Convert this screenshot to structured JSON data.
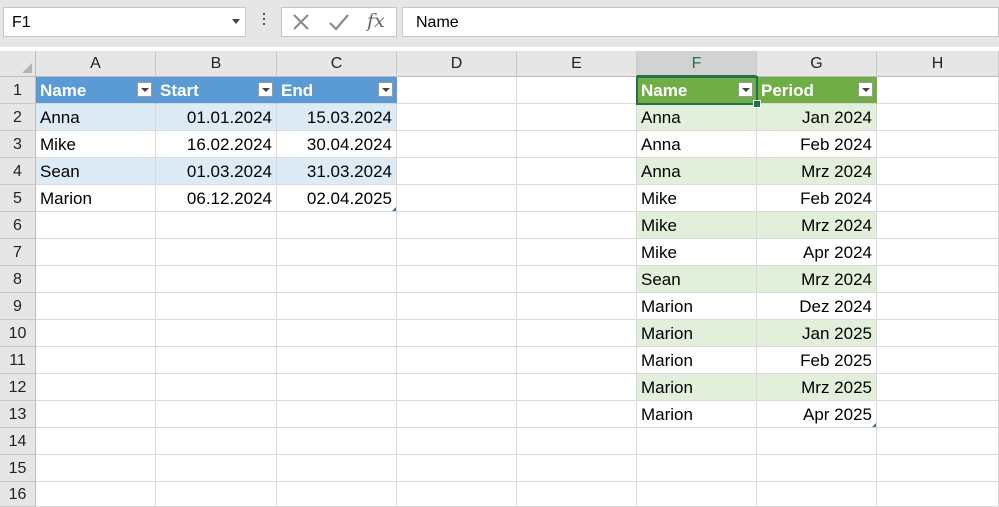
{
  "formula_bar": {
    "name_box": "F1",
    "formula": "Name",
    "fx_label": "fx"
  },
  "grid": {
    "columns": [
      "A",
      "B",
      "C",
      "D",
      "E",
      "F",
      "G",
      "H"
    ],
    "selected_column": "F",
    "rows": [
      "1",
      "2",
      "3",
      "4",
      "5",
      "6",
      "7",
      "8",
      "9",
      "10",
      "11",
      "12",
      "13",
      "14",
      "15",
      "16"
    ]
  },
  "table1": {
    "style_color": "#5b9bd5",
    "headers": [
      "Name",
      "Start",
      "End"
    ],
    "rows": [
      [
        "Anna",
        "01.01.2024",
        "15.03.2024"
      ],
      [
        "Mike",
        "16.02.2024",
        "30.04.2024"
      ],
      [
        "Sean",
        "01.03.2024",
        "31.03.2024"
      ],
      [
        "Marion",
        "06.12.2024",
        "02.04.2025"
      ]
    ]
  },
  "table2": {
    "style_color": "#70ad47",
    "headers": [
      "Name",
      "Period"
    ],
    "rows": [
      [
        "Anna",
        "Jan 2024"
      ],
      [
        "Anna",
        "Feb 2024"
      ],
      [
        "Anna",
        "Mrz 2024"
      ],
      [
        "Mike",
        "Feb 2024"
      ],
      [
        "Mike",
        "Mrz 2024"
      ],
      [
        "Mike",
        "Apr 2024"
      ],
      [
        "Sean",
        "Mrz 2024"
      ],
      [
        "Marion",
        "Dez 2024"
      ],
      [
        "Marion",
        "Jan 2025"
      ],
      [
        "Marion",
        "Feb 2025"
      ],
      [
        "Marion",
        "Mrz 2025"
      ],
      [
        "Marion",
        "Apr 2025"
      ]
    ]
  },
  "icons": {
    "cancel": "close-icon",
    "enter": "check-icon",
    "function": "fx-icon",
    "filter": "filter-dropdown-icon"
  }
}
